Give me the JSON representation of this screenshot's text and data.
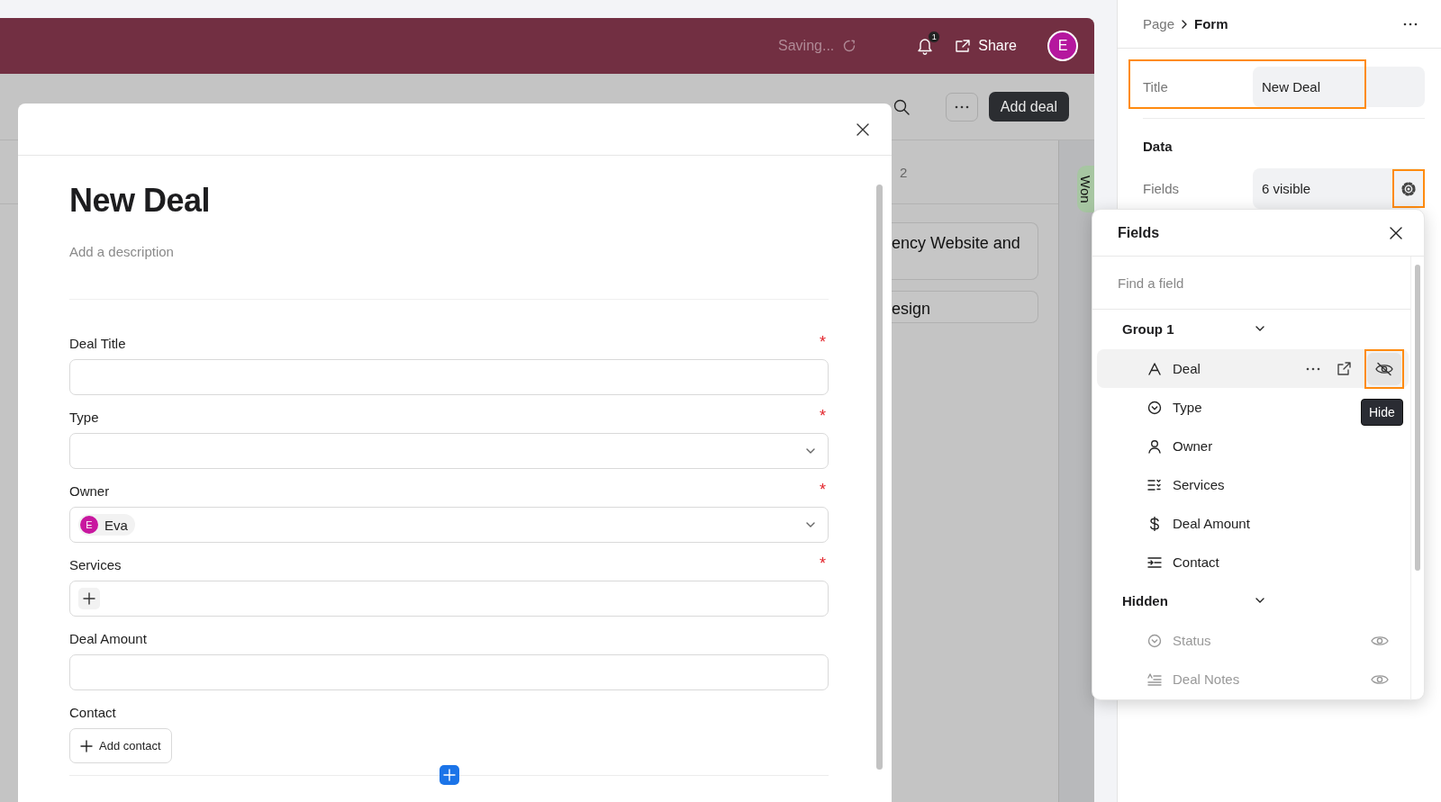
{
  "header": {
    "status": "Saving...",
    "notification_count": "1",
    "share": "Share",
    "avatar": "E"
  },
  "toolbar": {
    "add_button": "Add deal"
  },
  "board": {
    "column_count": "2",
    "cards": [
      "ency Website and",
      "esign"
    ],
    "next_column": "Won"
  },
  "modal": {
    "title": "New Deal",
    "description_placeholder": "Add a description",
    "fields": [
      {
        "kind": "text",
        "label": "Deal Title",
        "required_mark": "*"
      },
      {
        "kind": "select",
        "label": "Type",
        "required_mark": "*"
      },
      {
        "kind": "person",
        "label": "Owner",
        "required_mark": "*",
        "value": "Eva",
        "avatar": "E"
      },
      {
        "kind": "multi",
        "label": "Services",
        "required_mark": "*"
      },
      {
        "kind": "text",
        "label": "Deal Amount"
      },
      {
        "kind": "link",
        "label": "Contact",
        "button": "Add contact"
      }
    ]
  },
  "panel": {
    "breadcrumb": [
      "Page",
      "Form"
    ],
    "title_label": "Title",
    "title_value": "New Deal",
    "title_highlighted": true,
    "section": "Data",
    "fields_label": "Fields",
    "fields_value": "6 visible",
    "gear_highlighted": true
  },
  "fields_popover": {
    "title": "Fields",
    "search_placeholder": "Find a field",
    "tooltip": "Hide",
    "hide_button_highlighted": true,
    "groups": [
      {
        "name": "Group 1",
        "expanded": true,
        "items": [
          {
            "kind": "text",
            "label": "Deal",
            "hidden": false,
            "selected": true
          },
          {
            "kind": "select",
            "label": "Type",
            "hidden": false,
            "selected": false
          },
          {
            "kind": "person",
            "label": "Owner",
            "hidden": false,
            "selected": false
          },
          {
            "kind": "list",
            "label": "Services",
            "hidden": false,
            "selected": false
          },
          {
            "kind": "currency",
            "label": "Deal Amount",
            "hidden": false,
            "selected": false
          },
          {
            "kind": "contact",
            "label": "Contact",
            "hidden": false,
            "selected": false
          }
        ]
      },
      {
        "name": "Hidden",
        "expanded": true,
        "items": [
          {
            "kind": "select",
            "label": "Status",
            "hidden": true,
            "selected": false
          },
          {
            "kind": "notes",
            "label": "Deal Notes",
            "hidden": true,
            "selected": false
          }
        ]
      }
    ]
  }
}
